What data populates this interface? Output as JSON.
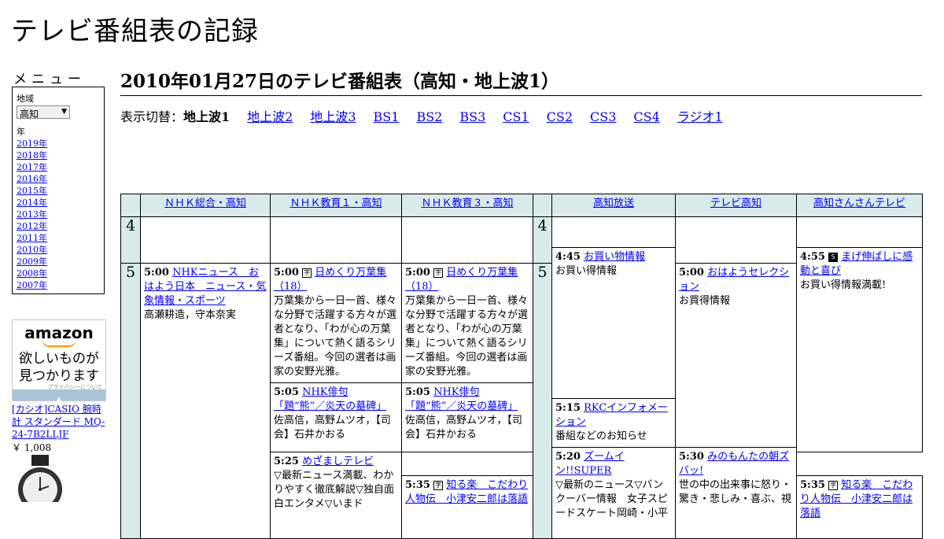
{
  "site_title": "テレビ番組表の記録",
  "menu": {
    "label": "メニュー",
    "region_label": "地域",
    "region_selected": "高知",
    "year_label": "年",
    "years": [
      "2019年",
      "2018年",
      "2017年",
      "2016年",
      "2015年",
      "2014年",
      "2013年",
      "2012年",
      "2011年",
      "2010年",
      "2009年",
      "2008年",
      "2007年"
    ]
  },
  "ad": {
    "logo": "amazon",
    "text_line1": "欲しいものが",
    "text_line2": "見つかります",
    "privacy": "プライバシーについて",
    "product_title": "[カシオ]CASIO 腕時計 スタンダード MQ-24-7B2LLJF",
    "product_price": "￥ 1,008"
  },
  "page_title": "2010年01月27日のテレビ番組表（高知・地上波1）",
  "switcher": {
    "label": "表示切替：",
    "current": "地上波1",
    "links": [
      "地上波2",
      "地上波3",
      "BS1",
      "BS2",
      "BS3",
      "CS1",
      "CS2",
      "CS3",
      "CS4",
      "ラジオ1"
    ]
  },
  "channels": [
    "ＮＨＫ総合・高知",
    "ＮＨＫ教育１・高知",
    "ＮＨＫ教育３・高知",
    "高知放送",
    "テレビ高知",
    "高知さんさんテレビ"
  ],
  "hours": [
    "4",
    "5"
  ],
  "icons": {
    "subtitle": "字",
    "stereo": "S"
  },
  "programs": {
    "nhk1_500": {
      "time": "5:00",
      "title": "NHKニュース　おはよう日本　ニュース・気象情報・スポーツ",
      "desc": "高瀬耕造，守本奈実"
    },
    "edu1_500": {
      "time": "5:00",
      "title": "日めくり万葉集（18）",
      "desc": "万葉集から一日一首、様々な分野で活躍する方々が選者となり、「わが心の万葉集」について熱く語るシリーズ番組。今回の選者は画家の安野光雅。"
    },
    "edu1_505": {
      "time": "5:05",
      "title": "NHK俳句「題“熊”／炎天の墓碑」",
      "desc": "佐高信，高野ムツオ，【司会】石井かおる"
    },
    "edu1_535": {
      "time": "5:35",
      "title": "知る楽　こだわり人物伝　小津安二郎は落語"
    },
    "edu3_500": {
      "time": "5:00",
      "title": "日めくり万葉集（18）",
      "desc": "万葉集から一日一首、様々な分野で活躍する方々が選者となり、「わが心の万葉集」について熱く語るシリーズ番組。今回の選者は画家の安野光雅。"
    },
    "edu3_505": {
      "time": "5:05",
      "title": "NHK俳句「題“熊”／炎天の墓碑」",
      "desc": "佐高信，高野ムツオ，【司会】石井かおる"
    },
    "edu3_535": {
      "time": "5:35",
      "title": "知る楽　こだわり人物伝　小津安二郎は落語"
    },
    "rkc_445": {
      "time": "4:45",
      "title": "お買い物情報",
      "desc": "お買い得情報"
    },
    "rkc_515": {
      "time": "5:15",
      "title": "RKCインフォメーション",
      "desc": "番組などのお知らせ"
    },
    "rkc_520": {
      "time": "5:20",
      "title": "ズームイン!!SUPER",
      "desc": "▽最新のニュース▽バンクーバー情報　女子スピードスケート岡崎・小平"
    },
    "kut_500": {
      "time": "5:00",
      "title": "おはようセレクション",
      "desc": "お買得情報"
    },
    "kut_530": {
      "time": "5:30",
      "title": "みのもんたの朝ズバッ!",
      "desc": "世の中の出来事に怒り・驚き・悲しみ・喜ぶ、視"
    },
    "kss_455": {
      "time": "4:55",
      "title": "まげ伸ばしに感動と喜び",
      "desc": "お買い得情報満載!"
    },
    "kss_525": {
      "time": "5:25",
      "title": "めざましテレビ",
      "desc": "▽最新ニュース満載、わかりやすく徹底解説▽独自面白エンタメ▽いまド"
    }
  }
}
